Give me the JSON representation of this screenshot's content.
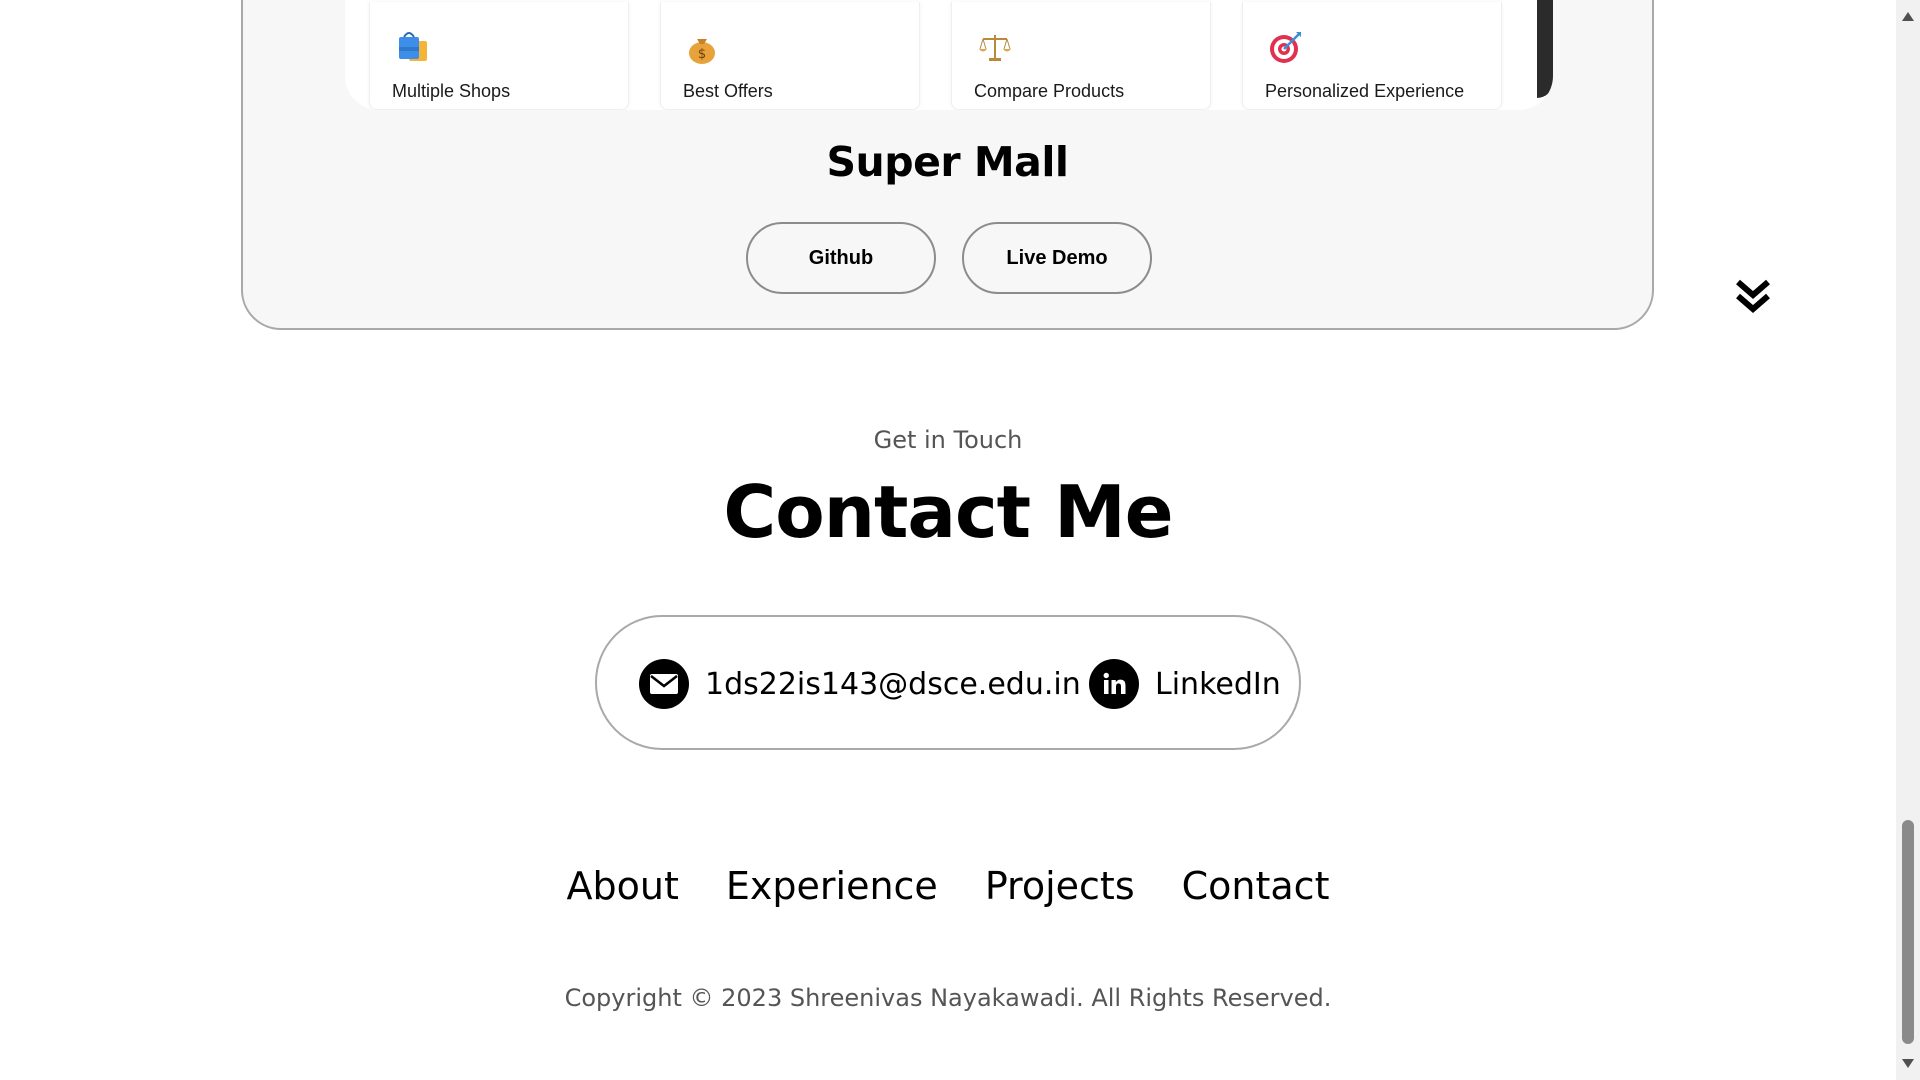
{
  "project": {
    "features": [
      {
        "label": "Multiple Shops",
        "icon": "shopping-bags-icon"
      },
      {
        "label": "Best Offers",
        "icon": "money-bag-icon"
      },
      {
        "label": "Compare Products",
        "icon": "balance-scale-icon"
      },
      {
        "label": "Personalized Experience",
        "icon": "target-icon"
      }
    ],
    "title": "Super Mall",
    "github_label": "Github",
    "demo_label": "Live Demo"
  },
  "contact": {
    "subtitle": "Get in Touch",
    "title": "Contact Me",
    "email": "1ds22is143@dsce.edu.in",
    "linkedin": "LinkedIn"
  },
  "footer": {
    "nav": [
      "About",
      "Experience",
      "Projects",
      "Contact"
    ],
    "copyright": "Copyright © 2023 Shreenivas Nayakawadi. All Rights Reserved."
  }
}
